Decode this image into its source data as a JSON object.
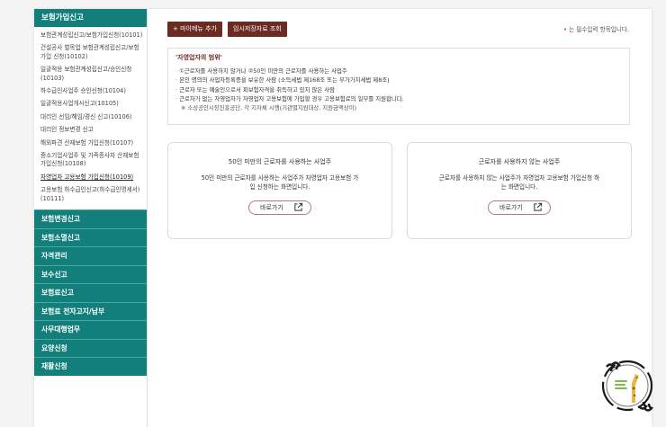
{
  "sidebar": {
    "header": "보험가입신고",
    "items": [
      {
        "label": "보험관계성립신고/보험가입신청(10101)",
        "active": false
      },
      {
        "label": "건설공사 벌목업 보험관계성립신고/보험가입 신청(10102)",
        "active": false
      },
      {
        "label": "일괄적용 보험관계성립신고/승인신청(10103)",
        "active": false
      },
      {
        "label": "하수급인사업주 승인신청(10104)",
        "active": false
      },
      {
        "label": "일괄적용사업개시신고(10105)",
        "active": false
      },
      {
        "label": "대리인 선임/해임/경신 신고(10106)",
        "active": false
      },
      {
        "label": "대리인 정보변경 신고",
        "active": false
      },
      {
        "label": "해외파견 산재보험 가입신청(10107)",
        "active": false
      },
      {
        "label": "중소기업사업주 및 가족종사자 산재보험가입신청(10108)",
        "active": false
      },
      {
        "label": "자영업자 고용보험 가입신청(10109)",
        "active": true
      },
      {
        "label": "고용보험 하수급인신고(하수급인명세서)(10111)",
        "active": false
      }
    ],
    "categories": [
      "보험변경신고",
      "보험소멸신고",
      "자격관리",
      "보수신고",
      "보험료신고",
      "보험료 전자고지/납부",
      "사무대행업무",
      "요양신청",
      "재활신청"
    ]
  },
  "toolbar": {
    "my_menu_label": "+ 마이메뉴 추가",
    "temp_save_label": "임시저장자료 조회",
    "required_star": "•",
    "required_text": "는 필수입력 항목입니다."
  },
  "info": {
    "title": "'자영업자의 범위'",
    "lines": [
      "①근로자를 사용하지 않거나 ②50인 미만의 근로자를 사용하는 사업주",
      "본인 명의의 사업자등록증을 보유한 사람 (소득세법 제168조 또는 부가가치세법 제8조)",
      "근로자 또는 예술인으로서 피보험자격을 취득하고 있지 않은 사람",
      "근로자가 없는 자영업자가 자영업자 고용보험에 가입할 경우 고용보험료의 일부를 지원합니다."
    ],
    "note": "※ 소상공인시장진흥공단, 각 지자체 시행(기관별지원대상, 지원금액상이)"
  },
  "cards": [
    {
      "title": "50인 미만의 근로자를 사용하는 사업주",
      "desc": "50인 미만의 근로자를 사용하는 사업주가 자영업자 고용보험 가입 신청하는 화면입니다.",
      "button": "바로가기"
    },
    {
      "title": "근로자를 사용하지 않는 사업주",
      "desc": "근로자를 사용하지 않는 사업주가 자영업자 고용보험 가입신청 하는 화면입니다.",
      "button": "바로가기"
    }
  ],
  "colors": {
    "sidebar_teal": "#137f7b",
    "button_brown": "#6b2a22",
    "required_red": "#d03a2a"
  },
  "icons": {
    "external_link": "external-link-icon",
    "mascot": "giraffe-mascot-logo"
  }
}
